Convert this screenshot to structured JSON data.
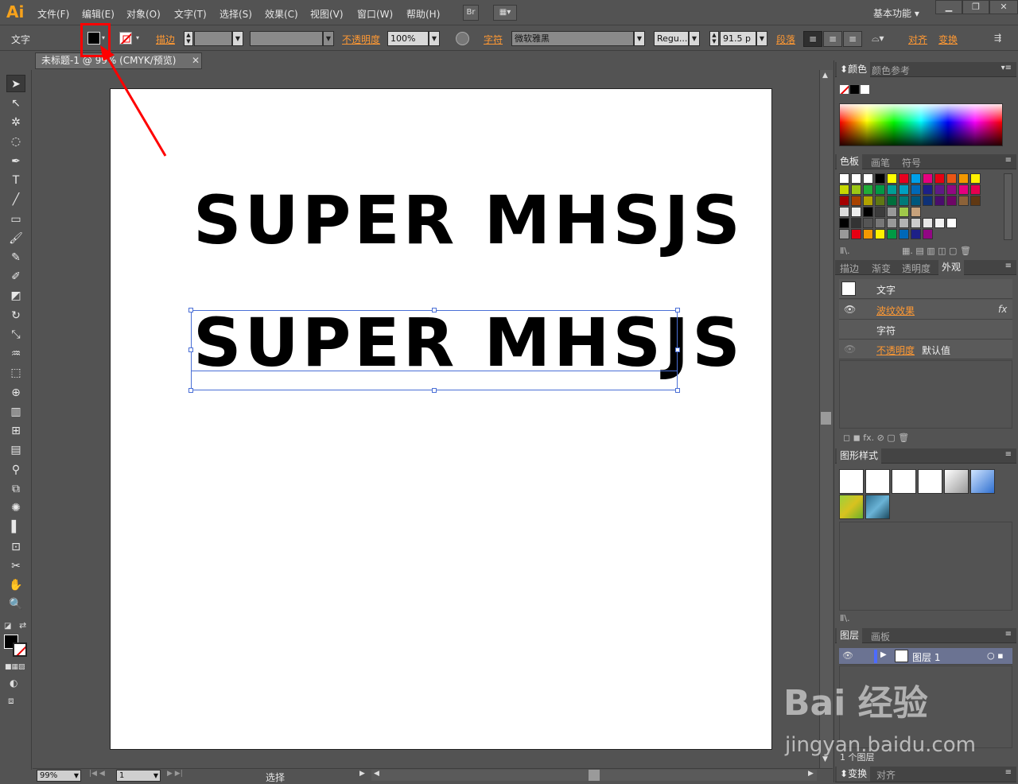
{
  "app": {
    "logo": "Ai",
    "workspace": "基本功能"
  },
  "menu": [
    "文件(F)",
    "编辑(E)",
    "对象(O)",
    "文字(T)",
    "选择(S)",
    "效果(C)",
    "视图(V)",
    "窗口(W)",
    "帮助(H)"
  ],
  "menu_buttons": {
    "bridge": "Br"
  },
  "control": {
    "object_type": "文字",
    "stroke_label": "描边",
    "opacity_label": "不透明度",
    "opacity_value": "100%",
    "char_label": "字符",
    "font_family": "微软雅黑",
    "font_style": "Regu...",
    "font_size": "91.5 p",
    "para_label": "段落",
    "align_label": "对齐",
    "transform_label": "变换",
    "fill_color": "#000000"
  },
  "document": {
    "tab_title": "未标题-1 @ 99% (CMYK/预览)"
  },
  "artwork": {
    "line1": "SUPER MHSJS",
    "line2": "SUPER MHSJS"
  },
  "status": {
    "zoom": "99%",
    "page": "1",
    "text": "选择"
  },
  "panels": {
    "color": {
      "tabs": [
        "颜色",
        "颜色参考"
      ]
    },
    "swatches": {
      "tabs": [
        "色板",
        "画笔",
        "符号"
      ]
    },
    "appearance": {
      "tabs": [
        "描边",
        "渐变",
        "透明度",
        "外观"
      ],
      "rows": {
        "title": "文字",
        "effect": "波纹效果",
        "char": "字符",
        "opacity_label": "不透明度",
        "opacity_value": "默认值"
      },
      "fx": "fx"
    },
    "graphic_styles": {
      "tab": "图形样式"
    },
    "layers": {
      "tabs": [
        "图层",
        "画板"
      ],
      "layer_name": "图层 1",
      "count": "1 个图层"
    },
    "bottom": {
      "tabs": [
        "变换",
        "对齐"
      ]
    }
  },
  "watermark": {
    "brand": "Bai 经验",
    "url": "jingyan.baidu.com"
  },
  "colors": {
    "accent": "#ff9933",
    "selection": "#4a6fd6",
    "annotation": "#ff0000"
  }
}
